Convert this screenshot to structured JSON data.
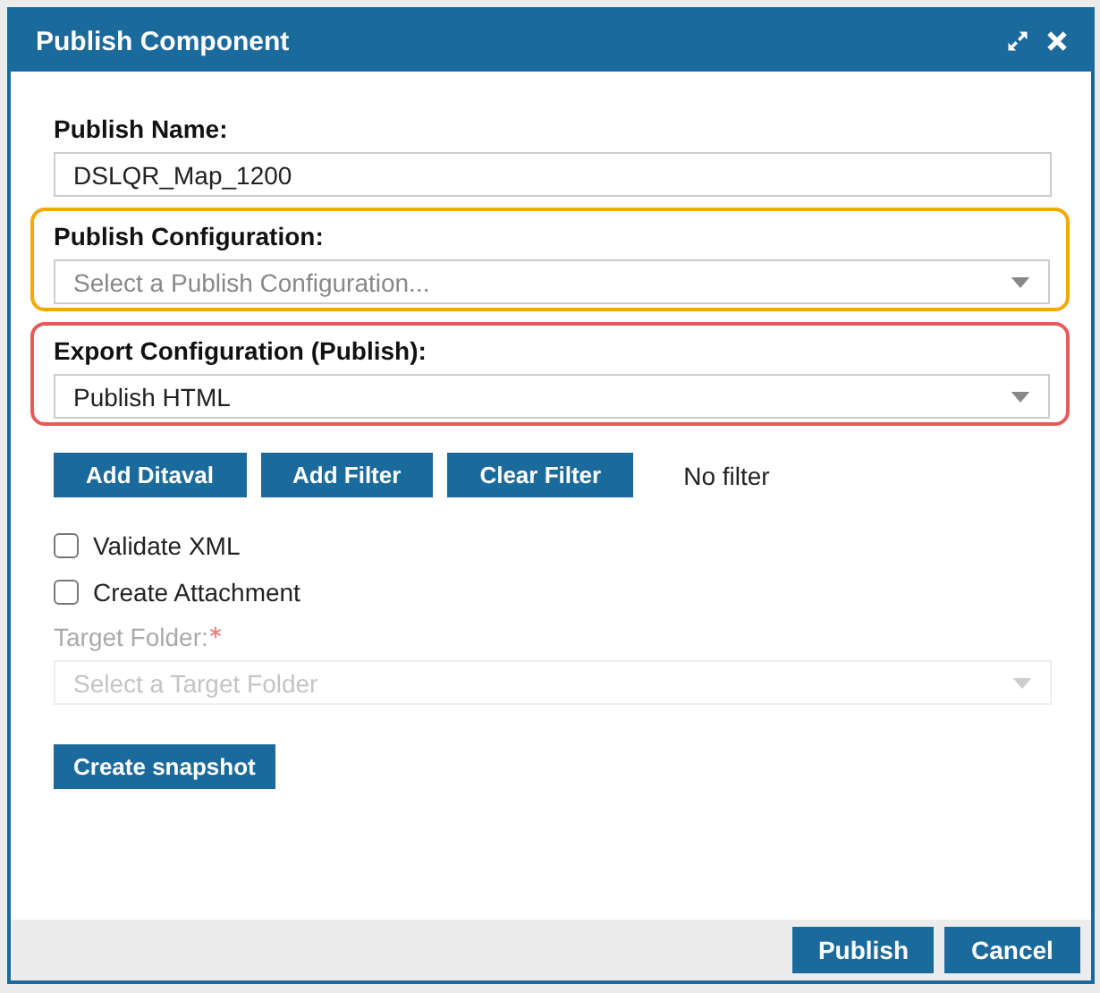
{
  "dialog": {
    "title": "Publish Component"
  },
  "fields": [
    {
      "kind": "text",
      "label": "Publish Name:",
      "value": "DSLQR_Map_1200"
    },
    {
      "kind": "select",
      "label": "Publish Configuration:",
      "placeholder": "Select a Publish Configuration...",
      "color": "#f5a800"
    },
    {
      "kind": "select",
      "label": "Export Configuration (Publish):",
      "value": "Publish HTML",
      "color": "#e85a5a"
    }
  ],
  "filter_buttons": [
    "Add Ditaval",
    "Add Filter",
    "Clear Filter"
  ],
  "filter_status": "No filter",
  "checkboxes": [
    {
      "label": "Validate XML",
      "checked": false
    },
    {
      "label": "Create Attachment",
      "checked": false
    }
  ],
  "target_folder": {
    "label": "Target Folder:",
    "required": true,
    "disabled": true,
    "placeholder": "Select a Target Folder"
  },
  "snapshot_button": "Create snapshot",
  "footer_buttons": [
    "Publish",
    "Cancel"
  ]
}
